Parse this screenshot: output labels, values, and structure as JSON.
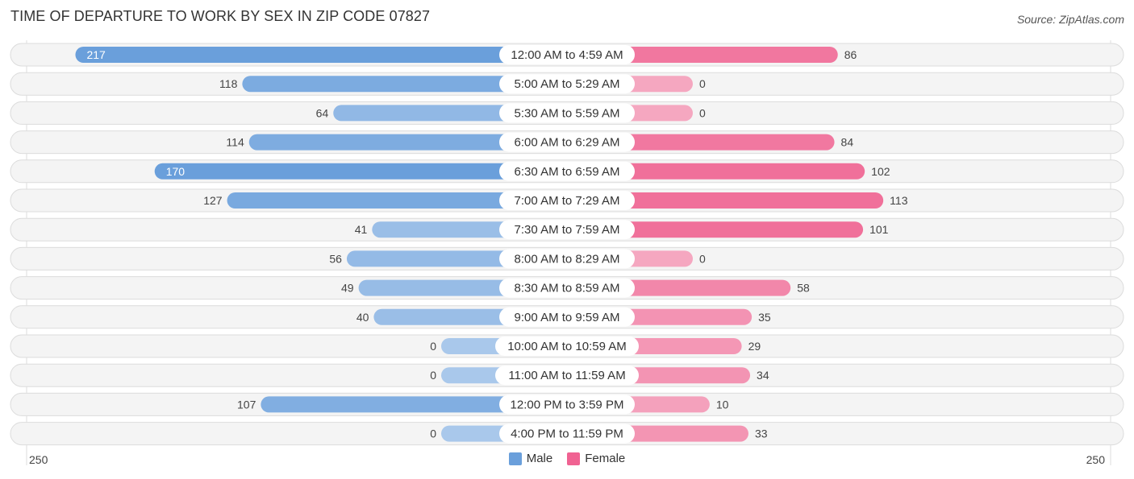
{
  "title": "TIME OF DEPARTURE TO WORK BY SEX IN ZIP CODE 07827",
  "source": "Source: ZipAtlas.com",
  "colors": {
    "male_strong": "#6a9fdb",
    "male_light": "#a9c8eb",
    "female_strong": "#f0709a",
    "female_light": "#f5a7c0",
    "row_bg": "#f2f2f2"
  },
  "legend": {
    "male": "Male",
    "female": "Female",
    "male_color": "#6a9fdb",
    "female_color": "#f06292"
  },
  "axis": {
    "left_label": "250",
    "right_label": "250"
  },
  "chart_data": {
    "type": "bar",
    "orientation": "horizontal-diverging",
    "title": "TIME OF DEPARTURE TO WORK BY SEX IN ZIP CODE 07827",
    "xlim": [
      -250,
      250
    ],
    "legend_position": "bottom-center",
    "categories": [
      "12:00 AM to 4:59 AM",
      "5:00 AM to 5:29 AM",
      "5:30 AM to 5:59 AM",
      "6:00 AM to 6:29 AM",
      "6:30 AM to 6:59 AM",
      "7:00 AM to 7:29 AM",
      "7:30 AM to 7:59 AM",
      "8:00 AM to 8:29 AM",
      "8:30 AM to 8:59 AM",
      "9:00 AM to 9:59 AM",
      "10:00 AM to 10:59 AM",
      "11:00 AM to 11:59 AM",
      "12:00 PM to 3:59 PM",
      "4:00 PM to 11:59 PM"
    ],
    "series": [
      {
        "name": "Male",
        "values": [
          217,
          118,
          64,
          114,
          170,
          127,
          41,
          56,
          49,
          40,
          0,
          0,
          107,
          0
        ]
      },
      {
        "name": "Female",
        "values": [
          86,
          0,
          0,
          84,
          102,
          113,
          101,
          0,
          58,
          35,
          29,
          34,
          10,
          33
        ]
      }
    ]
  }
}
